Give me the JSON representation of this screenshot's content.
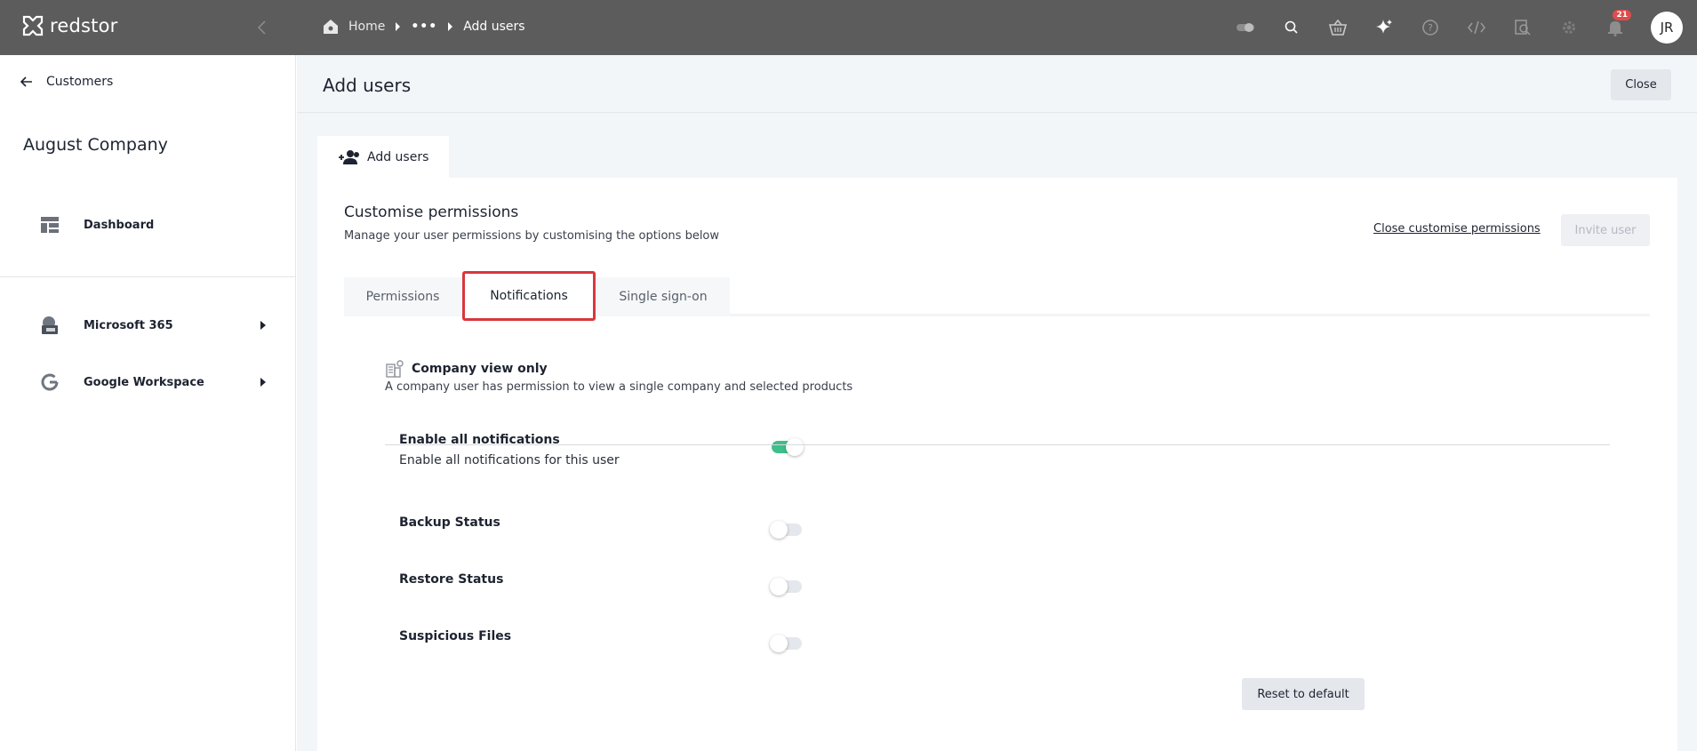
{
  "app": {
    "brand": "redstor"
  },
  "breadcrumb": {
    "home": "Home",
    "ellipsis": "•••",
    "current": "Add users"
  },
  "topbar": {
    "icons": [
      "toggle-icon",
      "search-icon",
      "basket-icon",
      "sparkle-icon",
      "help-icon",
      "code-icon",
      "inspect-icon",
      "gear-icon",
      "bell-icon"
    ],
    "notification_count": "21",
    "avatar_initials": "JR"
  },
  "sidebar": {
    "back_label": "Customers",
    "company_name": "August Company",
    "items": [
      {
        "label": "Dashboard",
        "icon": "dashboard-icon"
      },
      {
        "label": "Microsoft 365",
        "icon": "microsoft-365-icon"
      },
      {
        "label": "Google Workspace",
        "icon": "google-icon"
      }
    ]
  },
  "page": {
    "title": "Add users",
    "close_label": "Close",
    "content_tab": "Add users"
  },
  "card": {
    "title": "Customise permissions",
    "subtitle": "Manage your user permissions by customising the options below",
    "close_custom_label": "Close customise permissions",
    "invite_label": "Invite user"
  },
  "subtabs": [
    {
      "label": "Permissions",
      "active": false
    },
    {
      "label": "Notifications",
      "active": true
    },
    {
      "label": "Single sign-on",
      "active": false
    }
  ],
  "role": {
    "title": "Company view only",
    "description": "A company user has permission to view a single company and selected products"
  },
  "notifications": {
    "enable_all": {
      "label": "Enable all notifications",
      "sublabel": "Enable all notifications for this user",
      "on": true
    },
    "items": [
      {
        "label": "Backup Status",
        "on": false
      },
      {
        "label": "Restore Status",
        "on": false
      },
      {
        "label": "Suspicious Files",
        "on": false
      }
    ],
    "reset_label": "Reset to default"
  },
  "colors": {
    "topbar": "#5c5c5c",
    "toggle_on": "#3fbf8a",
    "highlight": "#d9363e",
    "badge": "#e04b4b"
  }
}
